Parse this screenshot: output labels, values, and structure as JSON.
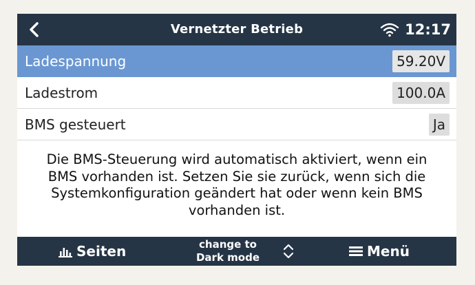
{
  "header": {
    "title": "Vernetzter Betrieb",
    "time": "12:17",
    "icons": {
      "back": "chevron-left-icon",
      "wifi": "wifi-icon"
    }
  },
  "settings": [
    {
      "label": "Ladespannung",
      "value": "59.20V",
      "selected": true
    },
    {
      "label": "Ladestrom",
      "value": "100.0A",
      "selected": false
    },
    {
      "label": "BMS gesteuert",
      "value": "Ja",
      "selected": false
    }
  ],
  "description": {
    "lines": [
      "Die BMS-Steuerung wird automatisch aktiviert, wenn ein",
      "BMS vorhanden ist. Setzen Sie sie zurück, wenn sich die",
      "Systemkonfiguration geändert hat oder wenn kein BMS",
      "vorhanden ist."
    ]
  },
  "footer": {
    "pages_label": "Seiten",
    "darkmode_line1": "change to",
    "darkmode_line2": "Dark mode",
    "menu_label": "Menü",
    "icons": {
      "pages": "bar-chart-icon",
      "darkmode": "up-down-chevron-icon",
      "menu": "hamburger-icon"
    }
  },
  "colors": {
    "bar_background": "#253545",
    "selected_row": "#6a97d2",
    "value_box": "#dddddd"
  }
}
